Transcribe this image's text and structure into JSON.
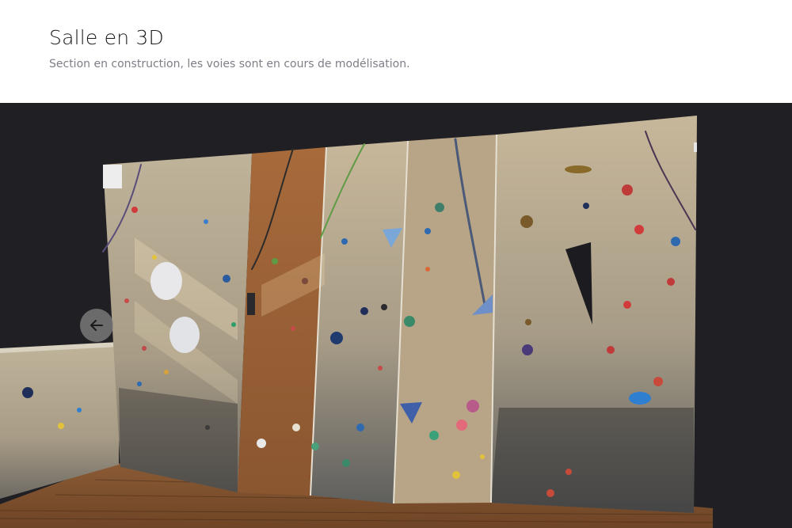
{
  "header": {
    "title": "Salle en 3D",
    "subtitle": "Section en construction, les voies sont en cours de modélisation."
  },
  "viewer": {
    "back_icon": "arrow-left-icon",
    "scene": "climbing-wall-3d-model"
  },
  "colors": {
    "viewer_background": "#202024",
    "title": "#1b1b1e",
    "subtitle": "#7d7f86"
  }
}
